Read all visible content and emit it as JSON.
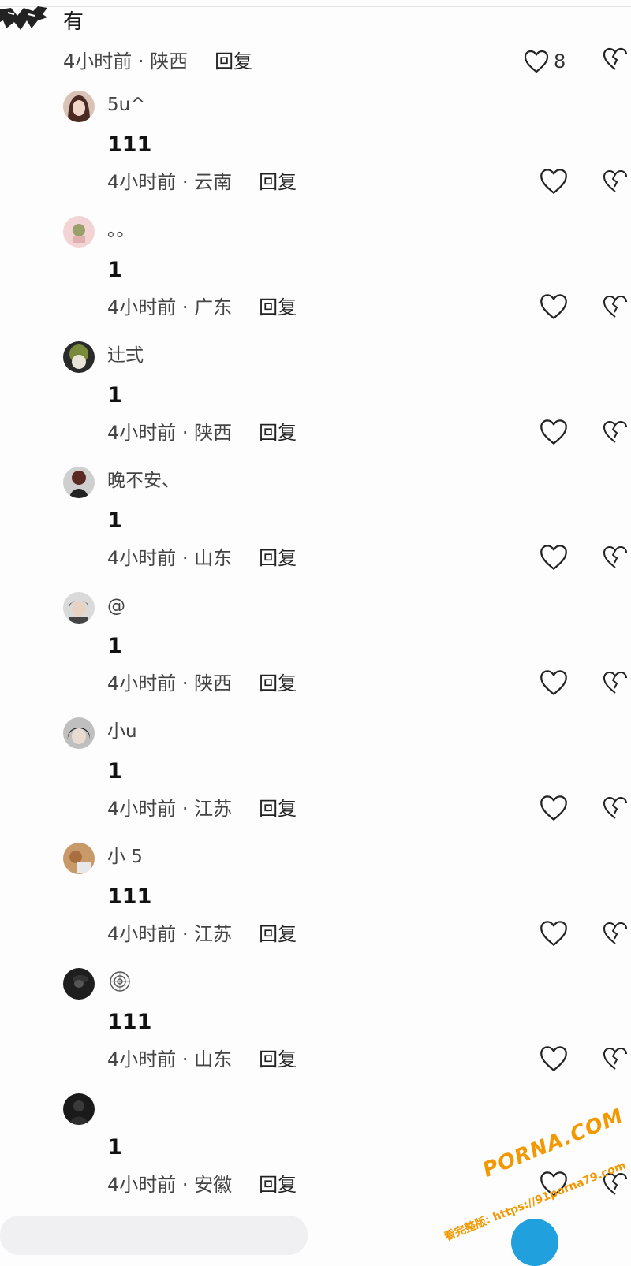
{
  "parent_comment": {
    "text": "有",
    "meta": "4小时前 · 陕西",
    "reply_label": "回复",
    "like_count": "8"
  },
  "replies": [
    {
      "username": "5u^",
      "content": "111",
      "meta": "4小时前 · 云南",
      "reply_label": "回复",
      "avatar_color": "#8a5a4a"
    },
    {
      "username": "。。",
      "content": "1",
      "meta": "4小时前 · 广东",
      "reply_label": "回复",
      "avatar_color": "#e8b9b9"
    },
    {
      "username": "辻弍",
      "content": "1",
      "meta": "4小时前 · 陕西",
      "reply_label": "回复",
      "avatar_color": "#6c7a3a"
    },
    {
      "username": "晚不安、",
      "content": "1",
      "meta": "4小时前 · 山东",
      "reply_label": "回复",
      "avatar_color": "#3a3a3a"
    },
    {
      "username": "@",
      "content": "1",
      "meta": "4小时前 · 陕西",
      "reply_label": "回复",
      "avatar_color": "#5a5a5a"
    },
    {
      "username": "小u",
      "content": "1",
      "meta": "4小时前 · 江苏",
      "reply_label": "回复",
      "avatar_color": "#2a2a2a"
    },
    {
      "username": "小 5",
      "content": "111",
      "meta": "4小时前 · 江苏",
      "reply_label": "回复",
      "avatar_color": "#b08050"
    },
    {
      "username": "",
      "content": "111",
      "meta": "4小时前 · 山东",
      "reply_label": "回复",
      "avatar_color": "#1e1e1e"
    },
    {
      "username": "",
      "content": "1",
      "meta": "4小时前 · 安徽",
      "reply_label": "回复",
      "avatar_color": "#1a1a1a"
    }
  ],
  "watermark": {
    "brand": "PORNA.COM",
    "url": "看完整版: https://91porna79.com"
  },
  "colors": {
    "background": "#fdfdfd",
    "send_button": "#20a0dc",
    "watermark": "#f39800"
  }
}
